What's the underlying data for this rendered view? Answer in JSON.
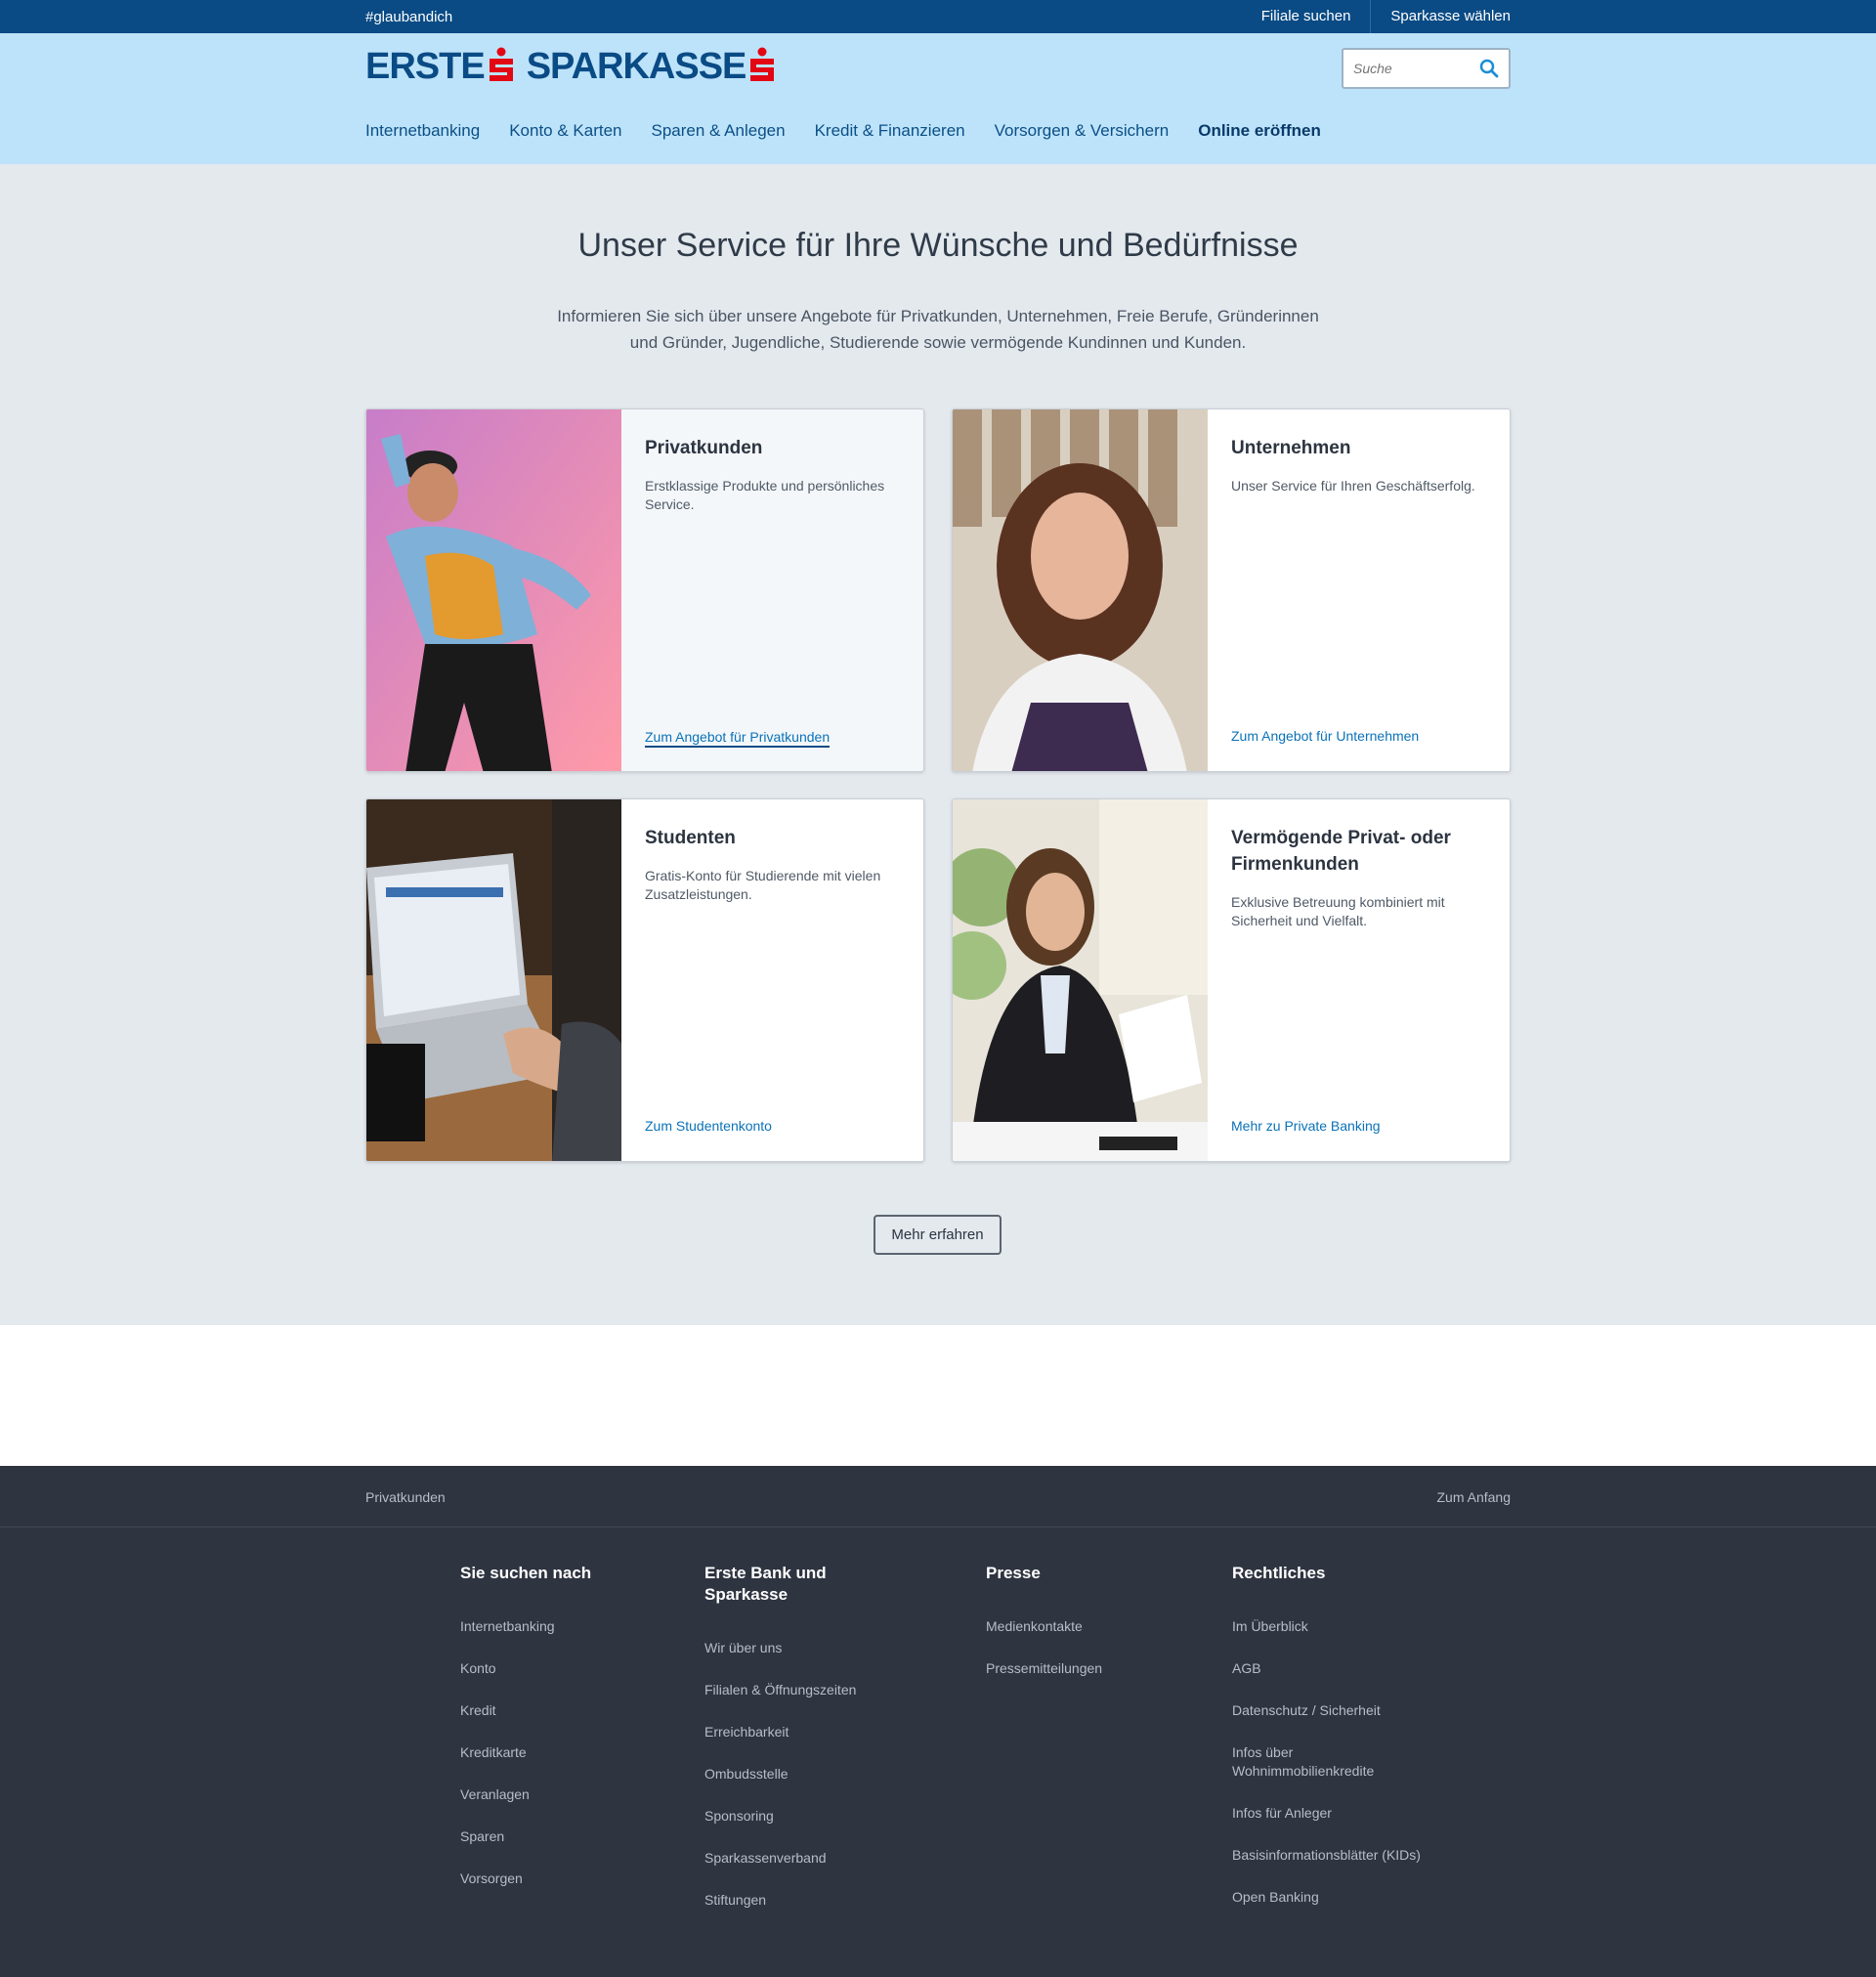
{
  "topbar": {
    "hashtag": "#glaubandich",
    "links": [
      "Filiale suchen",
      "Sparkasse wählen"
    ]
  },
  "header": {
    "logo_text_1": "ERSTE",
    "logo_text_2": "SPARKASSE",
    "search_placeholder": "Suche",
    "nav": [
      "Internetbanking",
      "Konto & Karten",
      "Sparen & Anlegen",
      "Kredit & Finanzieren",
      "Vorsorgen & Versichern",
      "Online eröffnen"
    ]
  },
  "main": {
    "title": "Unser Service für Ihre Wünsche und Bedürfnisse",
    "intro": "Informieren Sie sich über unsere Angebote für Privatkunden, Unternehmen, Freie Berufe, Gründerinnen und Gründer, Jugendliche, Studierende sowie vermögende Kundinnen und Kunden.",
    "cards": [
      {
        "title": "Privatkunden",
        "text": "Erstklassige Produkte und persönliches Service.",
        "link": "Zum Angebot für Privatkunden"
      },
      {
        "title": "Unternehmen",
        "text": "Unser Service für Ihren Geschäftserfolg.",
        "link": "Zum Angebot für Unternehmen"
      },
      {
        "title": "Studenten",
        "text": "Gratis-Konto für Studierende mit vielen Zusatzleistungen.",
        "link": "Zum Studentenkonto"
      },
      {
        "title": "Vermögende Privat- oder Firmenkunden",
        "text": "Exklusive Betreuung kombiniert mit Sicherheit und Vielfalt.",
        "link": "Mehr zu Private Banking"
      }
    ],
    "more_button": "Mehr erfahren"
  },
  "footer": {
    "breadcrumb": "Privatkunden",
    "to_top": "Zum Anfang",
    "columns": [
      {
        "title": "Sie suchen nach",
        "items": [
          "Internetbanking",
          "Konto",
          "Kredit",
          "Kreditkarte",
          "Veranlagen",
          "Sparen",
          "Vorsorgen"
        ]
      },
      {
        "title": "Erste Bank und Sparkasse",
        "items": [
          "Wir über uns",
          "Filialen & Öffnungszeiten",
          "Erreichbarkeit",
          "Ombudsstelle",
          "Sponsoring",
          "Sparkassenverband",
          "Stiftungen"
        ]
      },
      {
        "title": "Presse",
        "items": [
          "Medienkontakte",
          "Pressemitteilungen"
        ]
      },
      {
        "title": "Rechtliches",
        "items": [
          "Im Überblick",
          "AGB",
          "Datenschutz / Sicherheit",
          "Infos über Wohnimmobilienkredite",
          "Infos für Anleger",
          "Basisinformationsblätter (KIDs)",
          "Open Banking"
        ]
      }
    ]
  },
  "colors": {
    "brand_blue": "#0a4b85",
    "header_bg": "#bde3fa",
    "logo_red": "#e30613",
    "link_blue": "#0a72b8",
    "footer_bg": "#2e3440"
  }
}
